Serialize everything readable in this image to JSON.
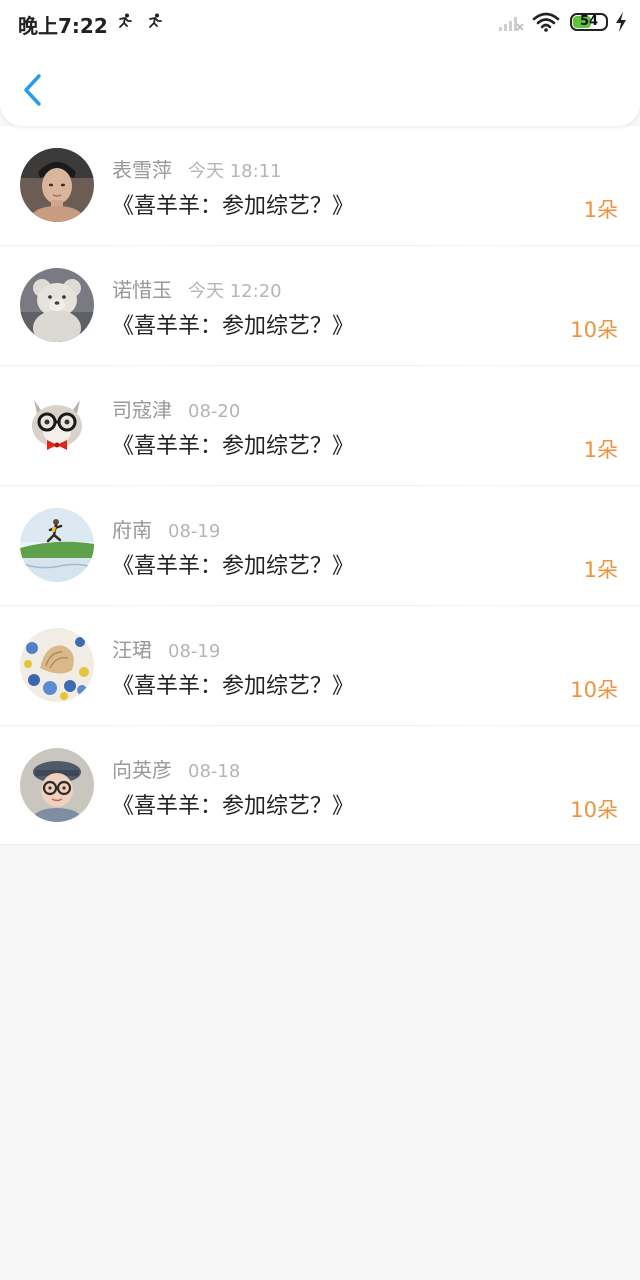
{
  "status_bar": {
    "time": "晚上7:22",
    "battery_level": "54",
    "battery_fraction": 0.54,
    "notification_icons": [
      "running-person-icon",
      "running-person-icon"
    ]
  },
  "nav": {
    "back_icon": "chevron-left-icon",
    "accent_color": "#2b9ce8"
  },
  "items": [
    {
      "name": "表雪萍",
      "time": "今天 18:11",
      "title": "《喜羊羊：参加综艺？》",
      "amount": "1朵",
      "avatar": "young-man-photo"
    },
    {
      "name": "诺惜玉",
      "time": "今天 12:20",
      "title": "《喜羊羊：参加综艺？》",
      "amount": "10朵",
      "avatar": "teddy-bear-photo"
    },
    {
      "name": "司寇津",
      "time": "08-20",
      "title": "《喜羊羊：参加综艺？》",
      "amount": "1朵",
      "avatar": "cat-with-glasses-photo"
    },
    {
      "name": "府南",
      "time": "08-19",
      "title": "《喜羊羊：参加综艺？》",
      "amount": "1朵",
      "avatar": "runner-on-grass-photo"
    },
    {
      "name": "汪珺",
      "time": "08-19",
      "title": "《喜羊羊：参加综艺？》",
      "amount": "10朵",
      "avatar": "seashell-and-glass-beads-photo"
    },
    {
      "name": "向英彦",
      "time": "08-18",
      "title": "《喜羊羊：参加综艺？》",
      "amount": "10朵",
      "avatar": "child-with-glasses-photo"
    }
  ],
  "colors": {
    "amount": "#f0923c",
    "name": "#999999",
    "title": "#222222",
    "background": "#f8f7f7"
  }
}
